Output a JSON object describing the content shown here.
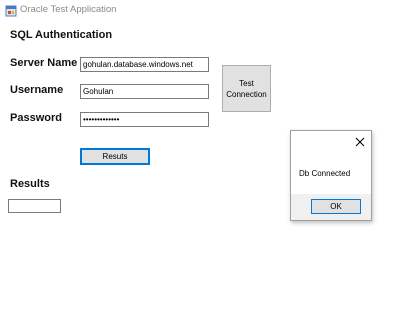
{
  "window": {
    "title": "Oracle Test Application",
    "icon": "app-window-icon"
  },
  "form": {
    "heading": "SQL Authentication",
    "server_label": "Server Name",
    "server_value": "gohulan.database.windows.net",
    "username_label": "Username",
    "username_value": "Gohulan",
    "password_label": "Password",
    "password_value": "•••••••••••••",
    "test_button": "Test\nConnection",
    "results_button": "Resuts",
    "results_label": "Results",
    "results_value": ""
  },
  "dialog": {
    "message": "Db Connected",
    "ok_label": "OK",
    "close_icon": "close-icon"
  },
  "colors": {
    "focus_border": "#0078d7",
    "button_face": "#e1e1e1"
  }
}
